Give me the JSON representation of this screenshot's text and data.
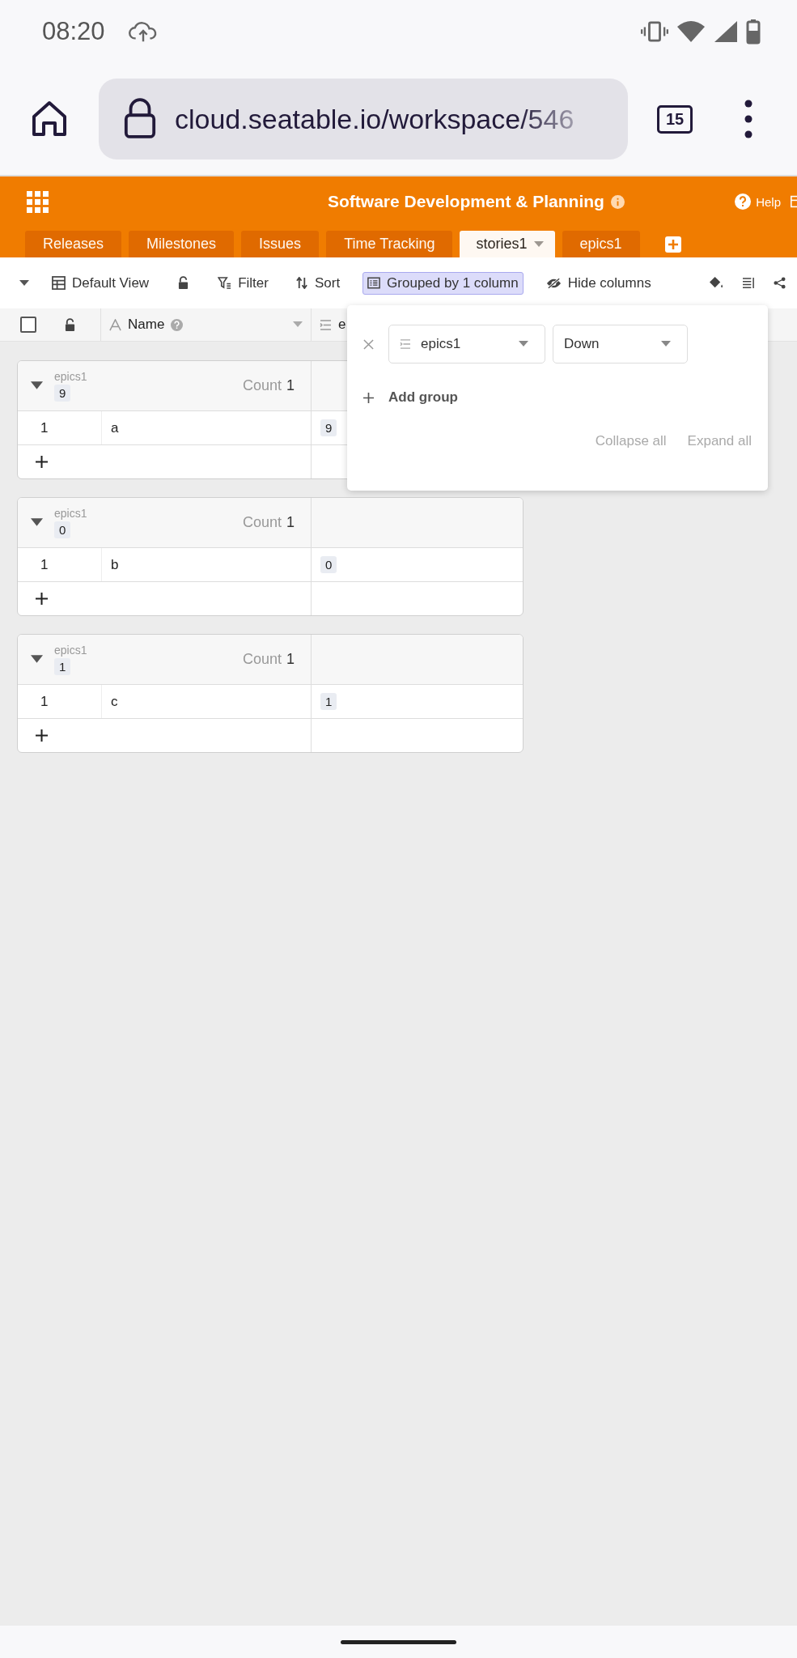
{
  "status_bar": {
    "time": "08:20"
  },
  "browser": {
    "url": "cloud.seatable.io/workspace/546",
    "tab_count": "15"
  },
  "app": {
    "title": "Software Development & Planning",
    "help": "Help"
  },
  "tabs": [
    {
      "label": "Releases",
      "selected": false
    },
    {
      "label": "Milestones",
      "selected": false
    },
    {
      "label": "Issues",
      "selected": false
    },
    {
      "label": "Time Tracking",
      "selected": false
    },
    {
      "label": "stories1",
      "selected": true
    },
    {
      "label": "epics1",
      "selected": false
    }
  ],
  "toolbar": {
    "view": "Default View",
    "items": [
      {
        "label": "Filter",
        "kind": "filter",
        "active": false
      },
      {
        "label": "Sort",
        "kind": "sort",
        "active": false
      },
      {
        "label": "Grouped by 1 column",
        "kind": "group",
        "active": true
      },
      {
        "label": "Hide columns",
        "kind": "hide",
        "active": false
      }
    ]
  },
  "select_all": {
    "checked": false
  },
  "columns": [
    {
      "label": "Name",
      "kind": "text"
    },
    {
      "label": "e",
      "kind": "link"
    }
  ],
  "groups": [
    {
      "field": "epics1",
      "value": "9",
      "count_label": "Count",
      "count": "1",
      "expanded": true,
      "rows": [
        {
          "index": "1",
          "name": "a",
          "link": "9"
        }
      ]
    },
    {
      "field": "epics1",
      "value": "0",
      "count_label": "Count",
      "count": "1",
      "expanded": true,
      "rows": [
        {
          "index": "1",
          "name": "b",
          "link": "0"
        }
      ]
    },
    {
      "field": "epics1",
      "value": "1",
      "count_label": "Count",
      "count": "1",
      "expanded": true,
      "rows": [
        {
          "index": "1",
          "name": "c",
          "link": "1"
        }
      ]
    }
  ],
  "group_panel": {
    "rules": [
      {
        "column": "epics1",
        "order": "Down"
      }
    ],
    "add_label": "Add group",
    "collapse_label": "Collapse all",
    "expand_label": "Expand all"
  }
}
